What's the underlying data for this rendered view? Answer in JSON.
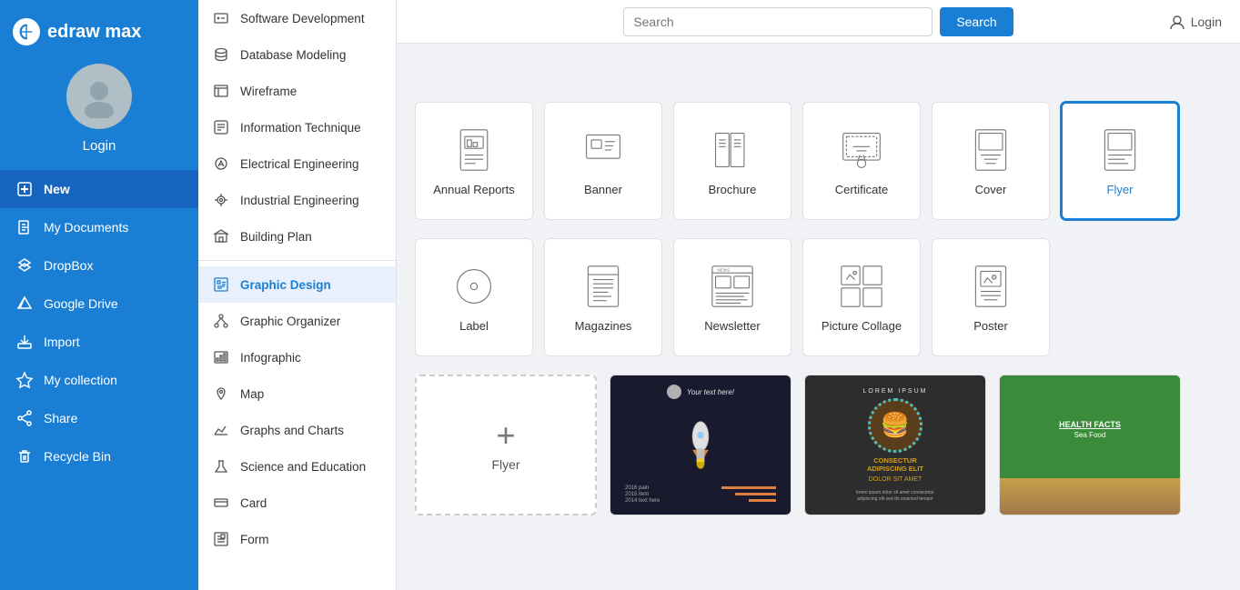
{
  "app": {
    "name": "edraw max",
    "logo_icon": "d-icon"
  },
  "sidebar": {
    "avatar_alt": "User avatar",
    "login_label": "Login",
    "nav_items": [
      {
        "id": "new",
        "label": "New",
        "icon": "plus-icon",
        "active": true
      },
      {
        "id": "my-documents",
        "label": "My Documents",
        "icon": "document-icon"
      },
      {
        "id": "dropbox",
        "label": "DropBox",
        "icon": "dropbox-icon"
      },
      {
        "id": "google-drive",
        "label": "Google Drive",
        "icon": "google-drive-icon"
      },
      {
        "id": "import",
        "label": "Import",
        "icon": "import-icon"
      },
      {
        "id": "my-collection",
        "label": "My collection",
        "icon": "star-icon"
      },
      {
        "id": "share",
        "label": "Share",
        "icon": "share-icon"
      },
      {
        "id": "recycle-bin",
        "label": "Recycle Bin",
        "icon": "trash-icon"
      }
    ]
  },
  "middle_menu": {
    "items_top": [
      {
        "id": "software-development",
        "label": "Software Development",
        "icon": "software-icon"
      },
      {
        "id": "database-modeling",
        "label": "Database Modeling",
        "icon": "database-icon"
      },
      {
        "id": "wireframe",
        "label": "Wireframe",
        "icon": "wireframe-icon"
      },
      {
        "id": "information-technique",
        "label": "Information Technique",
        "icon": "info-icon"
      },
      {
        "id": "electrical-engineering",
        "label": "Electrical Engineering",
        "icon": "electrical-icon"
      },
      {
        "id": "industrial-engineering",
        "label": "Industrial Engineering",
        "icon": "industrial-icon"
      },
      {
        "id": "building-plan",
        "label": "Building Plan",
        "icon": "building-icon"
      }
    ],
    "items_bottom": [
      {
        "id": "graphic-design",
        "label": "Graphic Design",
        "icon": "graphic-design-icon",
        "active": true
      },
      {
        "id": "graphic-organizer",
        "label": "Graphic Organizer",
        "icon": "graphic-organizer-icon"
      },
      {
        "id": "infographic",
        "label": "Infographic",
        "icon": "infographic-icon"
      },
      {
        "id": "map",
        "label": "Map",
        "icon": "map-icon"
      },
      {
        "id": "graphs-and-charts",
        "label": "Graphs and Charts",
        "icon": "charts-icon"
      },
      {
        "id": "science-and-education",
        "label": "Science and Education",
        "icon": "science-icon"
      },
      {
        "id": "card",
        "label": "Card",
        "icon": "card-icon"
      },
      {
        "id": "form",
        "label": "Form",
        "icon": "form-icon"
      }
    ]
  },
  "search": {
    "placeholder": "Search",
    "button_label": "Search"
  },
  "login": {
    "label": "Login"
  },
  "template_categories": [
    {
      "id": "annual-reports",
      "label": "Annual Reports",
      "selected": false
    },
    {
      "id": "banner",
      "label": "Banner",
      "selected": false
    },
    {
      "id": "brochure",
      "label": "Brochure",
      "selected": false
    },
    {
      "id": "certificate",
      "label": "Certificate",
      "selected": false
    },
    {
      "id": "cover",
      "label": "Cover",
      "selected": false
    },
    {
      "id": "flyer",
      "label": "Flyer",
      "selected": true
    },
    {
      "id": "label",
      "label": "Label",
      "selected": false
    },
    {
      "id": "magazines",
      "label": "Magazines",
      "selected": false
    },
    {
      "id": "newsletter",
      "label": "Newsletter",
      "selected": false
    },
    {
      "id": "picture-collage",
      "label": "Picture Collage",
      "selected": false
    },
    {
      "id": "poster",
      "label": "Poster",
      "selected": false
    }
  ],
  "new_flyer_label": "Flyer",
  "colors": {
    "primary": "#1a7fd4",
    "sidebar_bg": "#1a7fd4",
    "active_nav": "#1565c0"
  }
}
